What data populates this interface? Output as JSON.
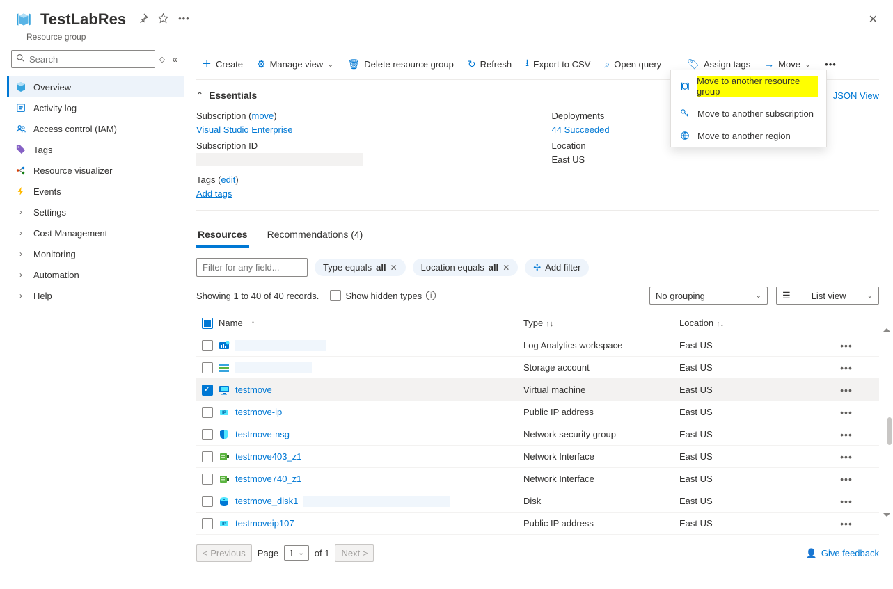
{
  "header": {
    "title": "TestLabRes",
    "subtitle": "Resource group"
  },
  "search": {
    "placeholder": "Search"
  },
  "nav": [
    {
      "label": "Overview",
      "icon": "cube",
      "active": true
    },
    {
      "label": "Activity log",
      "icon": "log"
    },
    {
      "label": "Access control (IAM)",
      "icon": "people"
    },
    {
      "label": "Tags",
      "icon": "tag"
    },
    {
      "label": "Resource visualizer",
      "icon": "graph"
    },
    {
      "label": "Events",
      "icon": "bolt"
    },
    {
      "label": "Settings",
      "icon": "chevron"
    },
    {
      "label": "Cost Management",
      "icon": "chevron"
    },
    {
      "label": "Monitoring",
      "icon": "chevron"
    },
    {
      "label": "Automation",
      "icon": "chevron"
    },
    {
      "label": "Help",
      "icon": "chevron"
    }
  ],
  "toolbar": {
    "create": "Create",
    "manage_view": "Manage view",
    "delete": "Delete resource group",
    "refresh": "Refresh",
    "export": "Export to CSV",
    "open_query": "Open query",
    "assign_tags": "Assign tags",
    "move": "Move"
  },
  "move_menu": [
    "Move to another resource group",
    "Move to another subscription",
    "Move to another region"
  ],
  "essentials": {
    "header": "Essentials",
    "json_view": "JSON View",
    "subscription_label": "Subscription",
    "subscription_move": "move",
    "subscription_value": "Visual Studio Enterprise",
    "subscription_id_label": "Subscription ID",
    "deployments_label": "Deployments",
    "deployments_value": "44 Succeeded",
    "location_label": "Location",
    "location_value": "East US",
    "tags_label": "Tags",
    "tags_edit": "edit",
    "add_tags": "Add tags"
  },
  "tabs": {
    "resources": "Resources",
    "recommendations": "Recommendations (4)"
  },
  "filters": {
    "placeholder": "Filter for any field...",
    "type_pill_prefix": "Type equals ",
    "type_pill_value": "all",
    "loc_pill_prefix": "Location equals ",
    "loc_pill_value": "all",
    "add_filter": "Add filter"
  },
  "summary": {
    "showing": "Showing 1 to 40 of 40 records.",
    "hidden": "Show hidden types",
    "grouping": "No grouping",
    "view": "List view"
  },
  "columns": {
    "name": "Name",
    "type": "Type",
    "location": "Location"
  },
  "rows": [
    {
      "name": "",
      "redactedW": 130,
      "type": "Log Analytics workspace",
      "location": "East US",
      "icon": "law",
      "link": false,
      "checked": false
    },
    {
      "name": "",
      "redactedW": 110,
      "type": "Storage account",
      "location": "East US",
      "icon": "storage",
      "link": false,
      "checked": false
    },
    {
      "name": "testmove",
      "type": "Virtual machine",
      "location": "East US",
      "icon": "vm",
      "link": true,
      "checked": true
    },
    {
      "name": "testmove-ip",
      "type": "Public IP address",
      "location": "East US",
      "icon": "ip",
      "link": true,
      "checked": false
    },
    {
      "name": "testmove-nsg",
      "type": "Network security group",
      "location": "East US",
      "icon": "nsg",
      "link": true,
      "checked": false
    },
    {
      "name": "testmove403_z1",
      "type": "Network Interface",
      "location": "East US",
      "icon": "nic",
      "link": true,
      "checked": false
    },
    {
      "name": "testmove740_z1",
      "type": "Network Interface",
      "location": "East US",
      "icon": "nic",
      "link": true,
      "checked": false
    },
    {
      "name": "testmove_disk1",
      "redactedSuffixW": 210,
      "type": "Disk",
      "location": "East US",
      "icon": "disk",
      "link": true,
      "checked": false
    },
    {
      "name": "testmoveip107",
      "type": "Public IP address",
      "location": "East US",
      "icon": "ip",
      "link": true,
      "checked": false
    }
  ],
  "pager": {
    "prev": "< Previous",
    "page_label": "Page",
    "page_num": "1",
    "of": "of 1",
    "next": "Next >",
    "feedback": "Give feedback"
  }
}
